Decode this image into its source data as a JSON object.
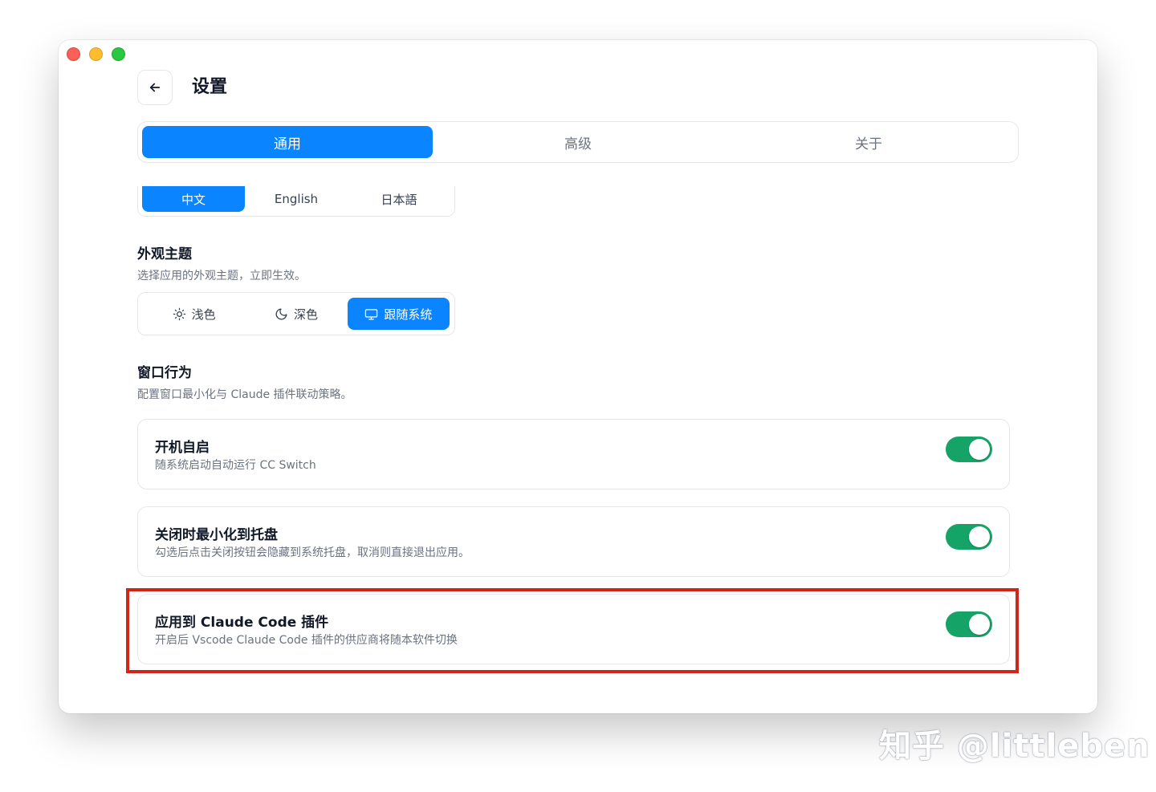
{
  "window": {
    "title": "设置"
  },
  "tabs": [
    {
      "label": "通用",
      "active": true
    },
    {
      "label": "高级",
      "active": false
    },
    {
      "label": "关于",
      "active": false
    }
  ],
  "language": {
    "options": [
      "中文",
      "English",
      "日本語"
    ],
    "selected": "中文"
  },
  "appearance": {
    "title": "外观主题",
    "description": "选择应用的外观主题，立即生效。",
    "options": [
      {
        "label": "浅色",
        "icon": "sun-icon"
      },
      {
        "label": "深色",
        "icon": "moon-icon"
      },
      {
        "label": "跟随系统",
        "icon": "monitor-icon"
      }
    ],
    "selected": "跟随系统"
  },
  "window_behavior": {
    "title": "窗口行为",
    "description": "配置窗口最小化与 Claude 插件联动策略。",
    "settings": [
      {
        "title": "开机自启",
        "description": "随系统启动自动运行 CC Switch",
        "enabled": true
      },
      {
        "title": "关闭时最小化到托盘",
        "description": "勾选后点击关闭按钮会隐藏到系统托盘，取消则直接退出应用。",
        "enabled": true
      },
      {
        "title": "应用到 Claude Code 插件",
        "description": "开启后 Vscode Claude Code 插件的供应商将随本软件切换",
        "enabled": true
      }
    ]
  },
  "watermark": "知乎 @littleben",
  "colors": {
    "accent": "#0a84ff",
    "toggle_on": "#16a368",
    "highlight_border": "#d1241b"
  }
}
